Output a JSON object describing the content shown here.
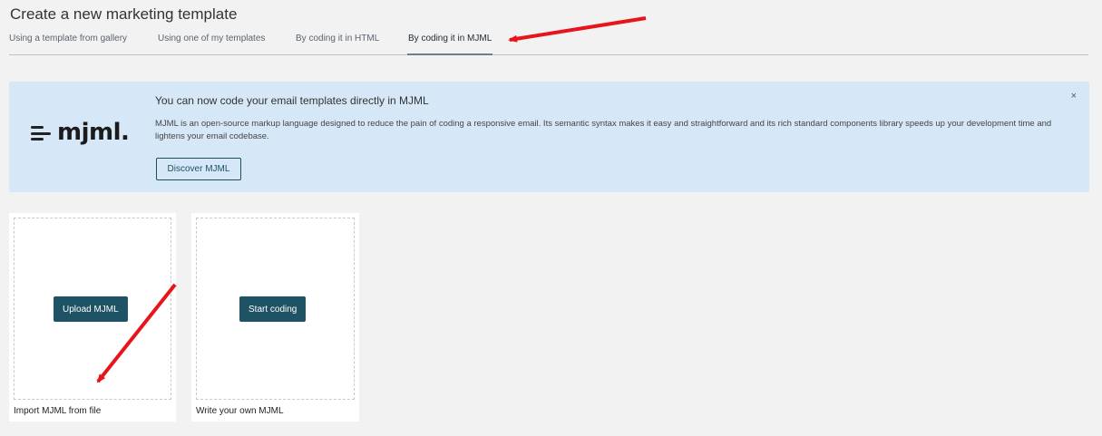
{
  "page": {
    "title": "Create a new marketing template"
  },
  "tabs": [
    {
      "label": "Using a template from gallery"
    },
    {
      "label": "Using one of my templates"
    },
    {
      "label": "By coding it in HTML"
    },
    {
      "label": "By coding it in MJML",
      "active": true
    }
  ],
  "banner": {
    "logo_text": "mjml.",
    "title": "You can now code your email templates directly in MJML",
    "description": "MJML is an open-source markup language designed to reduce the pain of coding a responsive email. Its semantic syntax makes it easy and straightforward and its rich standard components library speeds up your development time and lightens your email codebase.",
    "button_label": "Discover MJML",
    "close_label": "×"
  },
  "cards": [
    {
      "button_label": "Upload MJML",
      "caption": "Import MJML from file"
    },
    {
      "button_label": "Start coding",
      "caption": "Write your own MJML"
    }
  ],
  "colors": {
    "background": "#f2f2f2",
    "banner_bg": "#d6e8f8",
    "primary_button": "#1d5364",
    "annotation_arrow": "#e8141b"
  }
}
